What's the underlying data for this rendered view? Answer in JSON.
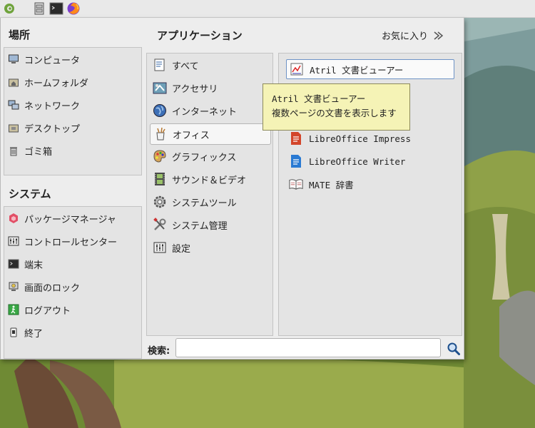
{
  "menu": {
    "places_title": "場所",
    "places": [
      {
        "label": "コンピュータ",
        "icon": "computer-icon"
      },
      {
        "label": "ホームフォルダ",
        "icon": "home-folder-icon"
      },
      {
        "label": "ネットワーク",
        "icon": "network-icon"
      },
      {
        "label": "デスクトップ",
        "icon": "desktop-icon"
      },
      {
        "label": "ゴミ箱",
        "icon": "trash-icon"
      }
    ],
    "system_title": "システム",
    "system": [
      {
        "label": "パッケージマネージャ",
        "icon": "package-icon"
      },
      {
        "label": "コントロールセンター",
        "icon": "control-center-icon"
      },
      {
        "label": "端末",
        "icon": "terminal-icon"
      },
      {
        "label": "画面のロック",
        "icon": "lock-screen-icon"
      },
      {
        "label": "ログアウト",
        "icon": "logout-icon"
      },
      {
        "label": "終了",
        "icon": "shutdown-icon"
      }
    ],
    "apps_title": "アプリケーション",
    "favorites_label": "お気に入り",
    "categories": [
      {
        "label": "すべて",
        "icon": "all-icon"
      },
      {
        "label": "アクセサリ",
        "icon": "accessories-icon"
      },
      {
        "label": "インターネット",
        "icon": "internet-icon"
      },
      {
        "label": "オフィス",
        "icon": "office-icon",
        "selected": true
      },
      {
        "label": "グラフィックス",
        "icon": "graphics-icon"
      },
      {
        "label": "サウンド＆ビデオ",
        "icon": "sound-video-icon"
      },
      {
        "label": "システムツール",
        "icon": "system-tools-icon"
      },
      {
        "label": "システム管理",
        "icon": "system-admin-icon"
      },
      {
        "label": "設定",
        "icon": "settings-icon"
      }
    ],
    "applications": [
      {
        "label": "Atril 文書ビューアー",
        "icon": "atril-icon",
        "focused": true
      },
      {
        "label": "LibreOffice Impress",
        "icon": "libreoffice-impress-icon"
      },
      {
        "label": "LibreOffice Writer",
        "icon": "libreoffice-writer-icon"
      },
      {
        "label": "MATE 辞書",
        "icon": "dictionary-icon"
      }
    ],
    "tooltip": {
      "title": "Atril 文書ビューアー",
      "description": "複数ページの文書を表示します"
    },
    "search": {
      "label": "検索:",
      "value": "",
      "placeholder": ""
    }
  },
  "colors": {
    "menu_bg": "#ededed",
    "focus_border": "#6e93c6",
    "tooltip_bg": "#f5f3b6"
  }
}
